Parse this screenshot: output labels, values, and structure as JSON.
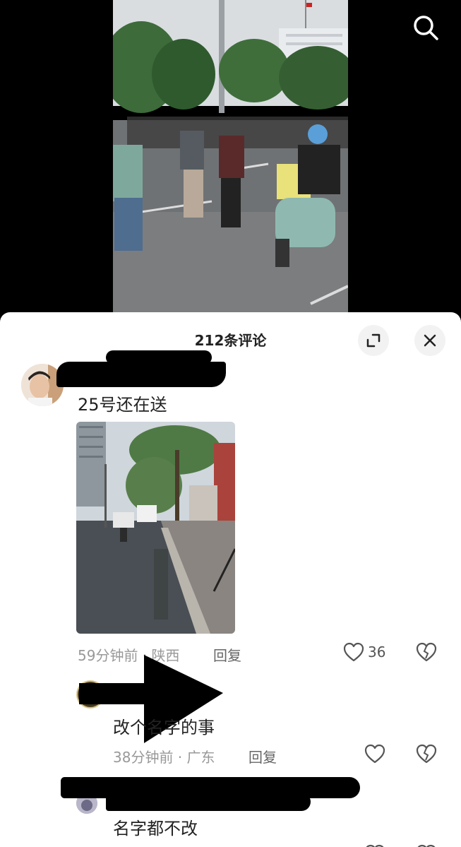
{
  "header": {
    "search_icon": "search-icon"
  },
  "sheet": {
    "title": "212条评论",
    "expand_icon": "expand-icon",
    "close_icon": "close-icon"
  },
  "comments": [
    {
      "text": "25号还在送",
      "time": "59分钟前",
      "location": "陕西",
      "reply_label": "回复",
      "likes": "36",
      "has_image": true
    },
    {
      "text": "改个名字的事",
      "time": "38分钟前",
      "location": "广东",
      "reply_label": "回复",
      "likes": ""
    },
    {
      "text": "名字都不改"
    }
  ],
  "separator": " · "
}
